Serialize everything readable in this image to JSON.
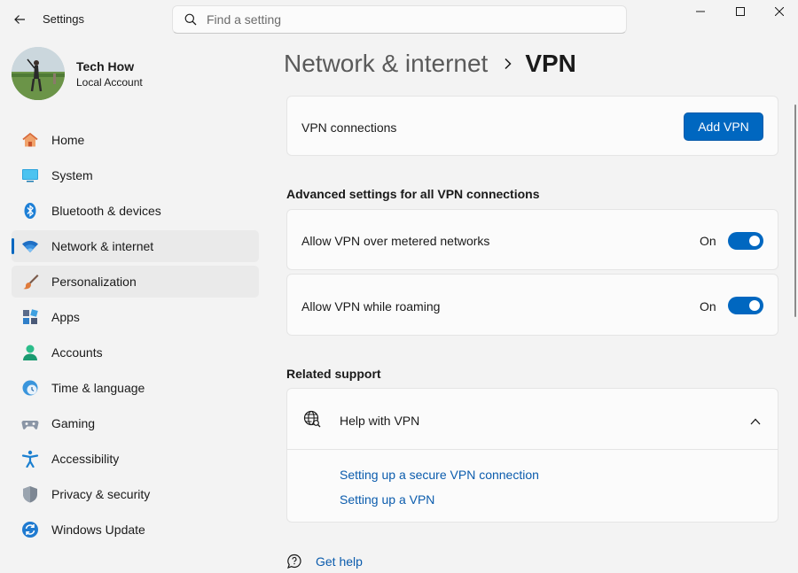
{
  "window": {
    "title": "Settings"
  },
  "search": {
    "placeholder": "Find a setting"
  },
  "profile": {
    "name": "Tech How",
    "account_type": "Local Account"
  },
  "sidebar": {
    "items": [
      {
        "label": "Home",
        "icon": "home-icon"
      },
      {
        "label": "System",
        "icon": "system-icon"
      },
      {
        "label": "Bluetooth & devices",
        "icon": "bluetooth-icon"
      },
      {
        "label": "Network & internet",
        "icon": "wifi-icon",
        "active": true
      },
      {
        "label": "Personalization",
        "icon": "brush-icon"
      },
      {
        "label": "Apps",
        "icon": "apps-icon"
      },
      {
        "label": "Accounts",
        "icon": "person-icon"
      },
      {
        "label": "Time & language",
        "icon": "clock-globe-icon"
      },
      {
        "label": "Gaming",
        "icon": "gamepad-icon"
      },
      {
        "label": "Accessibility",
        "icon": "accessibility-icon"
      },
      {
        "label": "Privacy & security",
        "icon": "shield-icon"
      },
      {
        "label": "Windows Update",
        "icon": "update-icon"
      }
    ]
  },
  "header": {
    "parent": "Network & internet",
    "current": "VPN"
  },
  "vpn": {
    "connections_label": "VPN connections",
    "add_button": "Add VPN"
  },
  "advanced": {
    "title": "Advanced settings for all VPN connections",
    "metered_label": "Allow VPN over metered networks",
    "metered_state": "On",
    "roaming_label": "Allow VPN while roaming",
    "roaming_state": "On"
  },
  "support": {
    "title": "Related support",
    "help_title": "Help with VPN",
    "links": [
      "Setting up a secure VPN connection",
      "Setting up a VPN"
    ]
  },
  "footer": {
    "get_help": "Get help"
  },
  "colors": {
    "accent": "#0067c0",
    "background": "#f3f3f3",
    "card": "#fbfbfb"
  }
}
